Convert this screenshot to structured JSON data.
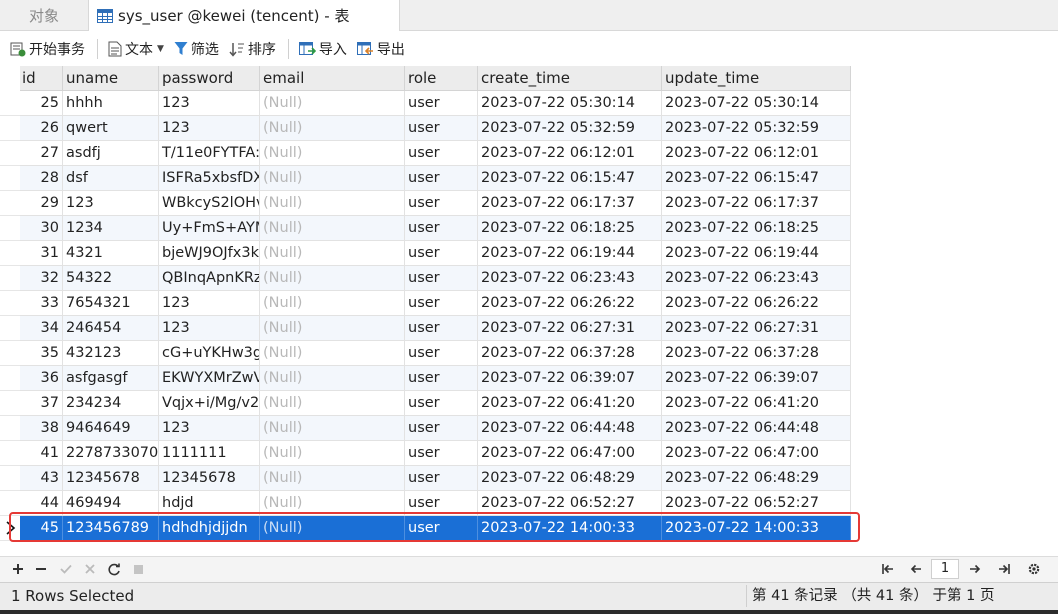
{
  "tabs": {
    "objects_label": "对象",
    "table_label": "sys_user @kewei (tencent) - 表"
  },
  "toolbar": {
    "begin_transaction": "开始事务",
    "text": "文本",
    "filter": "筛选",
    "sort": "排序",
    "import": "导入",
    "export": "导出"
  },
  "grid": {
    "columns": [
      "id",
      "uname",
      "password",
      "email",
      "role",
      "create_time",
      "update_time"
    ],
    "rows": [
      [
        "25",
        "hhhh",
        "123",
        "(Null)",
        "user",
        "2023-07-22 05:30:14",
        "2023-07-22 05:30:14"
      ],
      [
        "26",
        "qwert",
        "123",
        "(Null)",
        "user",
        "2023-07-22 05:32:59",
        "2023-07-22 05:32:59"
      ],
      [
        "27",
        "asdfj",
        "T/11e0FYTFA:",
        "(Null)",
        "user",
        "2023-07-22 06:12:01",
        "2023-07-22 06:12:01"
      ],
      [
        "28",
        "dsf",
        "ISFRa5xbsfDX",
        "(Null)",
        "user",
        "2023-07-22 06:15:47",
        "2023-07-22 06:15:47"
      ],
      [
        "29",
        "123",
        "WBkcyS2lOHv",
        "(Null)",
        "user",
        "2023-07-22 06:17:37",
        "2023-07-22 06:17:37"
      ],
      [
        "30",
        "1234",
        "Uy+FmS+AYM",
        "(Null)",
        "user",
        "2023-07-22 06:18:25",
        "2023-07-22 06:18:25"
      ],
      [
        "31",
        "4321",
        "bjeWJ9OJfx3k",
        "(Null)",
        "user",
        "2023-07-22 06:19:44",
        "2023-07-22 06:19:44"
      ],
      [
        "32",
        "54322",
        "QBInqApnKRz",
        "(Null)",
        "user",
        "2023-07-22 06:23:43",
        "2023-07-22 06:23:43"
      ],
      [
        "33",
        "7654321",
        "123",
        "(Null)",
        "user",
        "2023-07-22 06:26:22",
        "2023-07-22 06:26:22"
      ],
      [
        "34",
        "246454",
        "123",
        "(Null)",
        "user",
        "2023-07-22 06:27:31",
        "2023-07-22 06:27:31"
      ],
      [
        "35",
        "432123",
        "cG+uYKHw3g",
        "(Null)",
        "user",
        "2023-07-22 06:37:28",
        "2023-07-22 06:37:28"
      ],
      [
        "36",
        "asfgasgf",
        "EKWYXMrZwV",
        "(Null)",
        "user",
        "2023-07-22 06:39:07",
        "2023-07-22 06:39:07"
      ],
      [
        "37",
        "234234",
        "Vqjx+i/Mg/v2",
        "(Null)",
        "user",
        "2023-07-22 06:41:20",
        "2023-07-22 06:41:20"
      ],
      [
        "38",
        "9464649",
        "123",
        "(Null)",
        "user",
        "2023-07-22 06:44:48",
        "2023-07-22 06:44:48"
      ],
      [
        "41",
        "2278733070",
        "1111111",
        "(Null)",
        "user",
        "2023-07-22 06:47:00",
        "2023-07-22 06:47:00"
      ],
      [
        "43",
        "12345678",
        "12345678",
        "(Null)",
        "user",
        "2023-07-22 06:48:29",
        "2023-07-22 06:48:29"
      ],
      [
        "44",
        "469494",
        "hdjd",
        "(Null)",
        "user",
        "2023-07-22 06:52:27",
        "2023-07-22 06:52:27"
      ],
      [
        "45",
        "123456789",
        "hdhdhjdjjdn",
        "(Null)",
        "user",
        "2023-07-22 14:00:33",
        "2023-07-22 14:00:33"
      ]
    ],
    "selected_row_index": 17
  },
  "pager": {
    "current_page": "1"
  },
  "status": {
    "selection": "1 Rows Selected",
    "records": "第 41 条记录 （共 41 条） 于第 1 页"
  },
  "colors": {
    "selection": "#1a6fd6",
    "highlight_box": "#e53935",
    "null_text": "#b8b8b8"
  },
  "icons": [
    "table-icon",
    "transaction-icon",
    "text-icon",
    "filter-icon",
    "sort-icon",
    "import-icon",
    "export-icon",
    "add-icon",
    "delete-icon",
    "apply-icon",
    "discard-icon",
    "refresh-icon",
    "stop-icon",
    "first-page-icon",
    "prev-page-icon",
    "next-page-icon",
    "last-page-icon",
    "settings-icon"
  ]
}
